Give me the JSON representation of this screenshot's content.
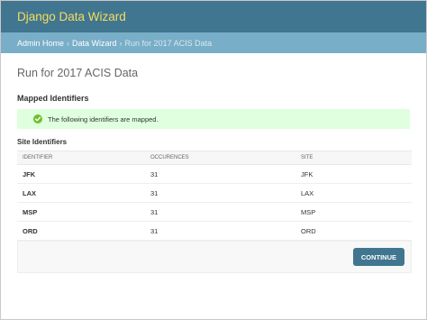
{
  "header": {
    "site_title": "Django Data Wizard"
  },
  "breadcrumbs": {
    "items": [
      "Admin Home",
      "Data Wizard"
    ],
    "separator": "›",
    "current": "Run for 2017 ACIS Data"
  },
  "page": {
    "title": "Run for 2017 ACIS Data",
    "section_heading": "Mapped Identifiers",
    "success_message": "The following identifiers are mapped.",
    "subheading": "Site Identifiers"
  },
  "table": {
    "columns": [
      "IDENTIFIER",
      "OCCURENCES",
      "SITE"
    ],
    "rows": [
      {
        "identifier": "JFK",
        "occurences": "31",
        "site": "JFK"
      },
      {
        "identifier": "LAX",
        "occurences": "31",
        "site": "LAX"
      },
      {
        "identifier": "MSP",
        "occurences": "31",
        "site": "MSP"
      },
      {
        "identifier": "ORD",
        "occurences": "31",
        "site": "ORD"
      }
    ]
  },
  "actions": {
    "continue_label": "CONTINUE"
  },
  "colors": {
    "header_bg": "#417690",
    "title_yellow": "#f5dd5d",
    "breadcrumb_bg": "#79aec8",
    "success_bg": "#dfffdf",
    "success_icon": "#70bf2b",
    "button_bg": "#417690"
  },
  "icons": {
    "success": "check-circle-icon"
  }
}
